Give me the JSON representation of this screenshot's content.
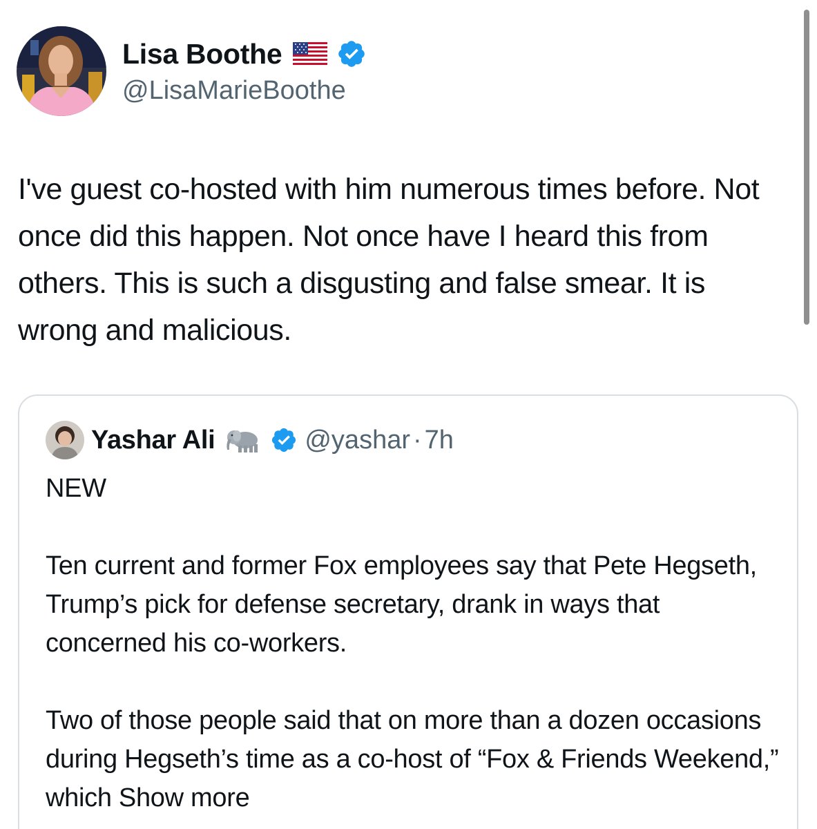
{
  "author": {
    "display_name": "Lisa Boothe",
    "handle": "@LisaMarieBoothe",
    "flag_icon": "us-flag-icon",
    "verified_icon": "verified-badge-icon",
    "verified_color": "#1d9bf0"
  },
  "tweet": {
    "text": "I've guest co-hosted with him numerous times before. Not once did this happen. Not once have I heard this from others. This is such a disgusting and false smear. It is wrong and malicious."
  },
  "quoted_tweet": {
    "display_name": "Yashar Ali",
    "emoji_icon": "elephant-icon",
    "verified_icon": "verified-badge-icon",
    "handle": "@yashar",
    "separator": "·",
    "time": "7h",
    "paragraph_1": "NEW",
    "paragraph_2": "Ten current and former Fox employees say that Pete Hegseth, Trump’s pick for defense secretary, drank in ways that concerned his co-workers.",
    "paragraph_3": "Two of those people said that on more than a dozen occasions during Hegseth’s time as a co-host of “Fox & Friends Weekend,” which",
    "show_more_label": "Show more"
  },
  "colors": {
    "text_primary": "#0f1419",
    "text_secondary": "#536471",
    "border": "#d8dee3"
  }
}
